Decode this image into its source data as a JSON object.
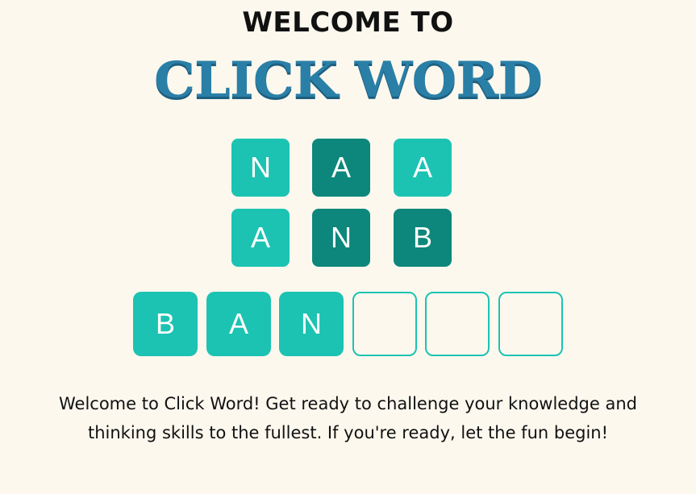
{
  "header": {
    "subtitle": "WELCOME TO",
    "logo_text": "CLICK WORD"
  },
  "letter_grid": {
    "rows": [
      [
        {
          "letter": "N",
          "shade": "light"
        },
        {
          "letter": "A",
          "shade": "dark"
        },
        {
          "letter": "A",
          "shade": "light"
        }
      ],
      [
        {
          "letter": "A",
          "shade": "light"
        },
        {
          "letter": "N",
          "shade": "dark"
        },
        {
          "letter": "B",
          "shade": "dark"
        }
      ]
    ]
  },
  "answer_slots": [
    {
      "letter": "B"
    },
    {
      "letter": "A"
    },
    {
      "letter": "N"
    },
    {
      "letter": ""
    },
    {
      "letter": ""
    },
    {
      "letter": ""
    }
  ],
  "description": "Welcome to Click Word! Get ready to challenge your knowledge and thinking skills to the fullest. If you're ready, let the fun begin!",
  "colors": {
    "background": "#fcf8ee",
    "tile_light": "#1cc3b2",
    "tile_dark": "#0d877b",
    "logo": "#2a7fa7"
  }
}
